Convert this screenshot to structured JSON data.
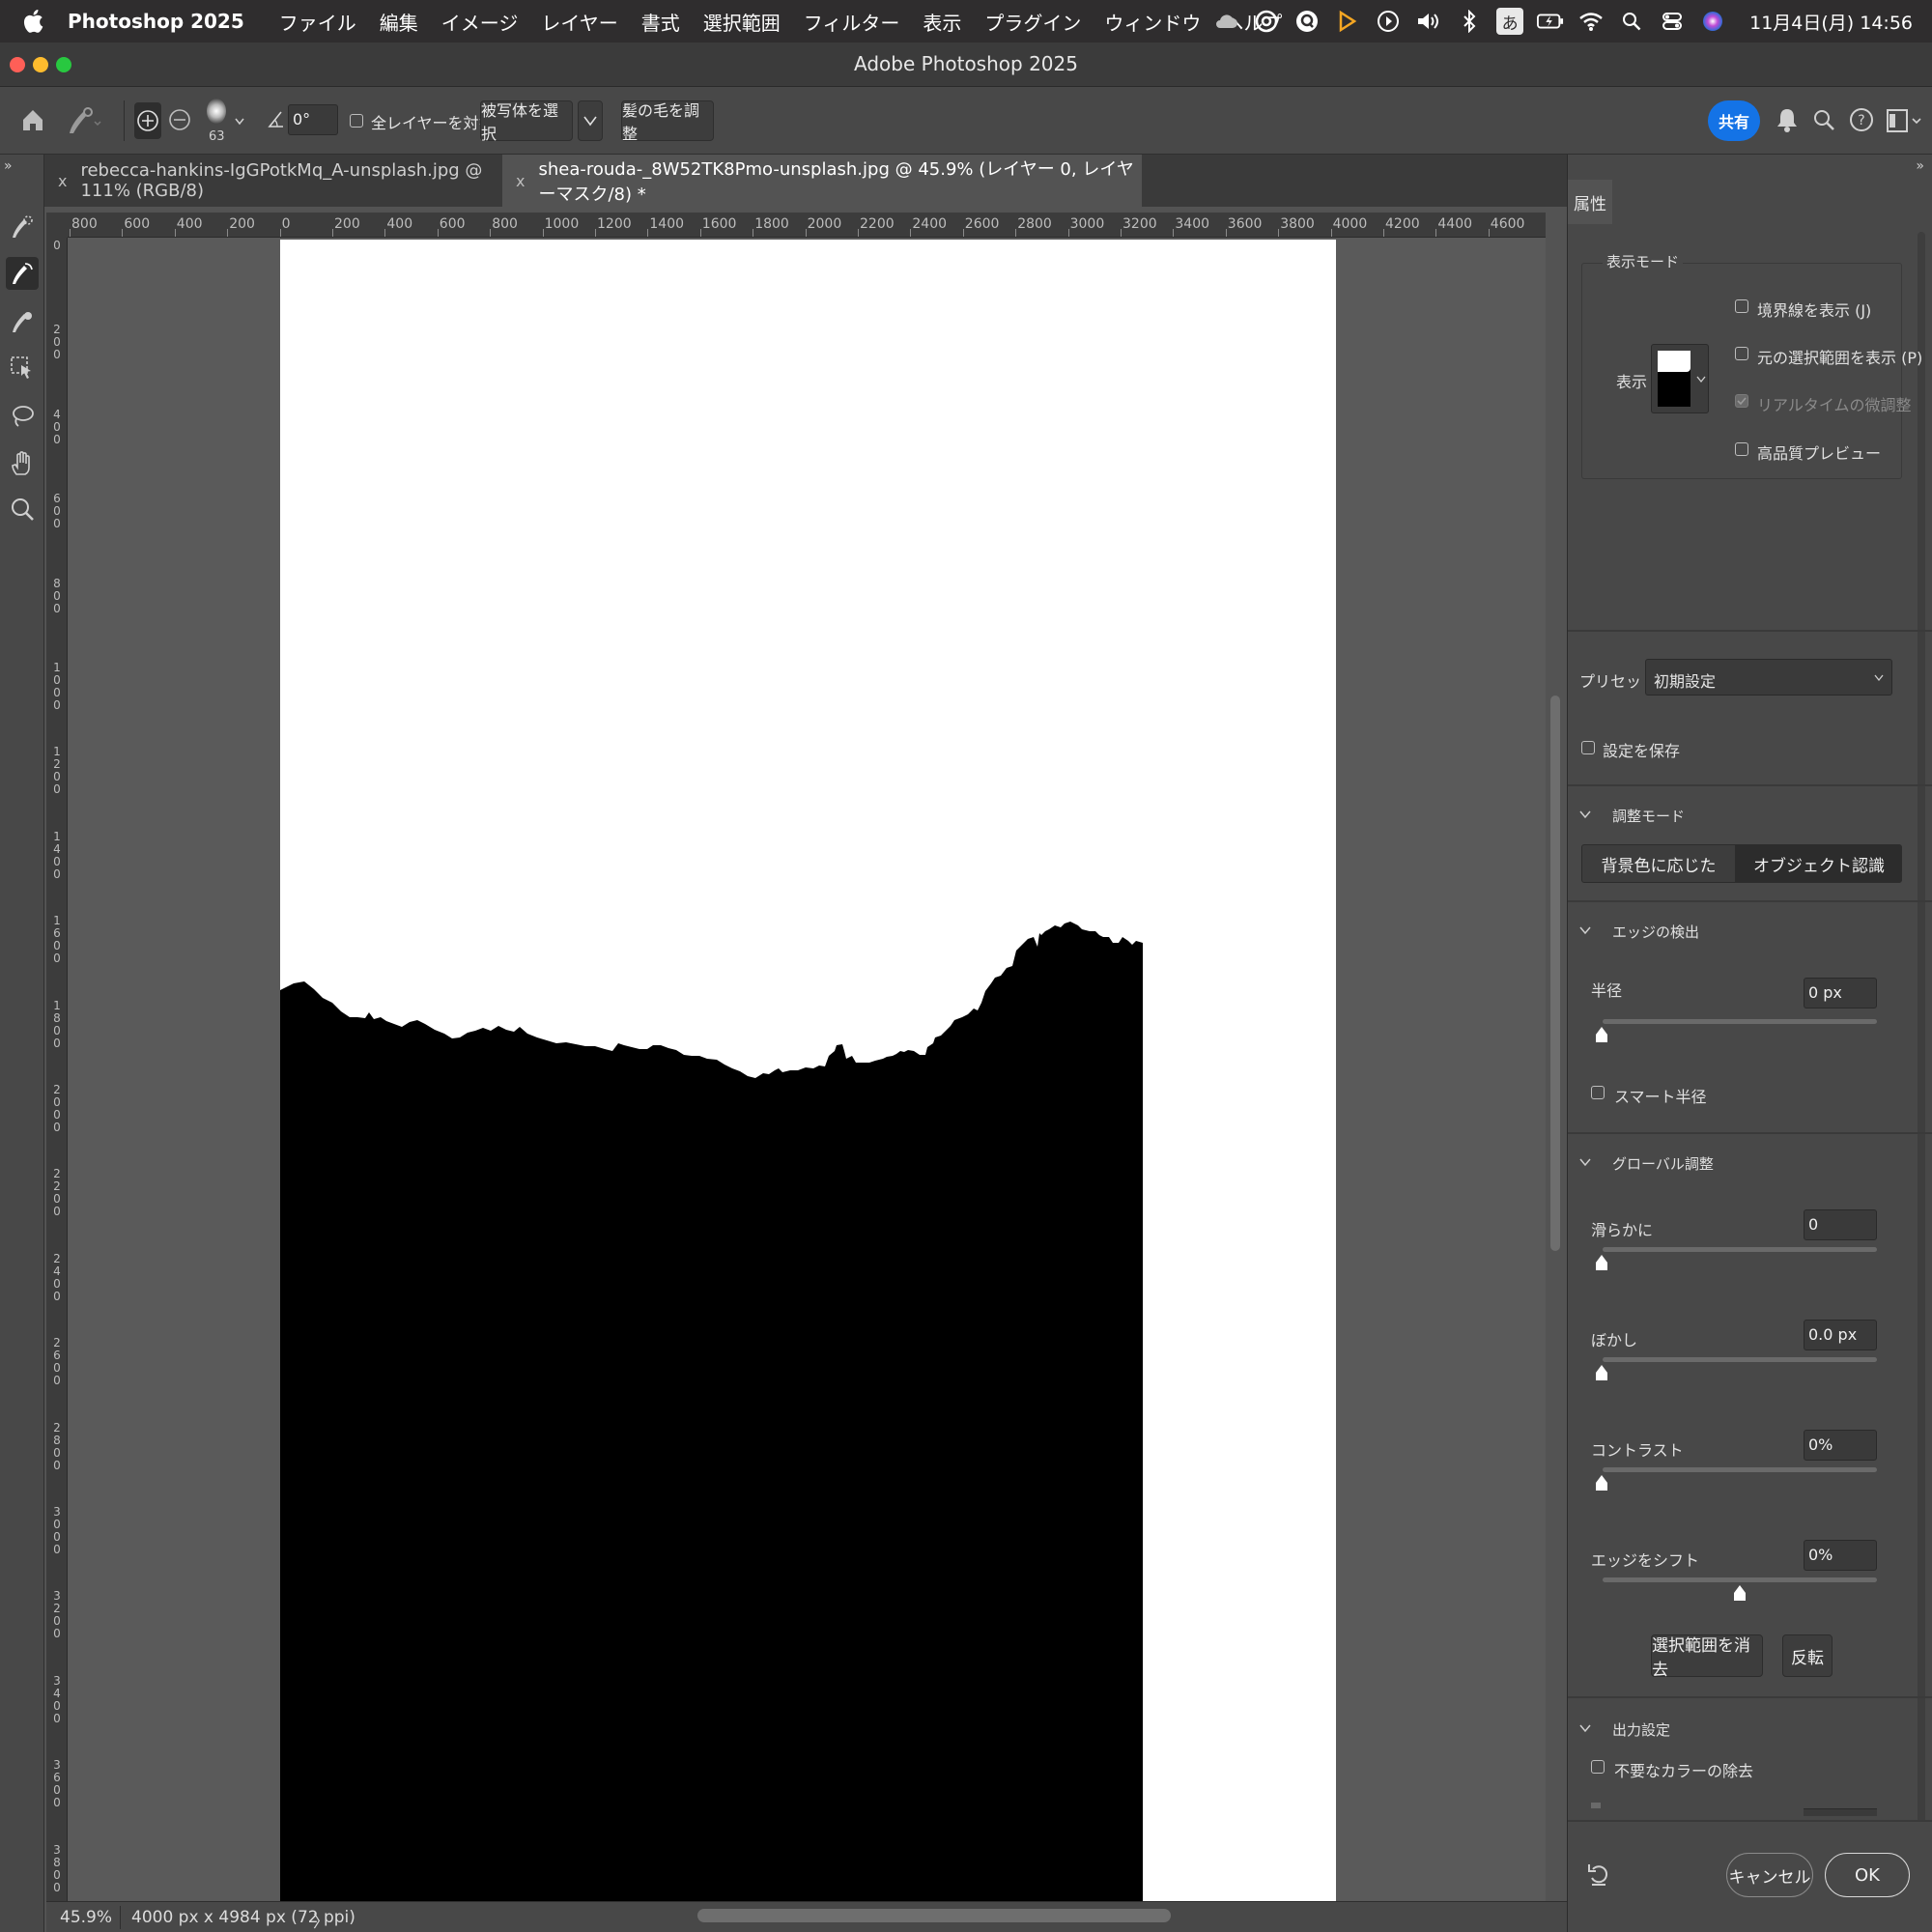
{
  "menubar": {
    "app_name": "Photoshop 2025",
    "items": [
      "ファイル",
      "編集",
      "イメージ",
      "レイヤー",
      "書式",
      "選択範囲",
      "フィルター",
      "表示",
      "プラグイン",
      "ウィンドウ",
      "ヘルプ"
    ],
    "ime": "あ",
    "clock": "11月4日(月) 14:56"
  },
  "window": {
    "title": "Adobe Photoshop 2025"
  },
  "options": {
    "brush_size": "63",
    "angle": "0°",
    "sample_all_layers": "全レイヤーを対象",
    "select_subject": "被写体を選択",
    "refine_hair": "髪の毛を調整",
    "share": "共有"
  },
  "tabs": [
    {
      "label": "rebecca-hankins-IgGPotkMq_A-unsplash.jpg @ 111% (RGB/8)",
      "close": "x"
    },
    {
      "label": "shea-rouda-_8W52TK8Pmo-unsplash.jpg @ 45.9% (レイヤー 0, レイヤーマスク/8) *",
      "close": "x"
    }
  ],
  "ruler": {
    "h_ticks": [
      "800",
      "600",
      "400",
      "200",
      "0",
      "200",
      "400",
      "600",
      "800",
      "1000",
      "1200",
      "1400",
      "1600",
      "1800",
      "2000",
      "2200",
      "2400",
      "2600",
      "2800",
      "3000",
      "3200",
      "3400",
      "3600",
      "3800",
      "4000",
      "4200",
      "4400",
      "4600"
    ],
    "v_ticks": [
      "0",
      "200",
      "400",
      "600",
      "800",
      "1000",
      "1200",
      "1400",
      "1600",
      "1800",
      "2000",
      "2200",
      "2400",
      "2600",
      "2800",
      "3000",
      "3200",
      "3400",
      "3600",
      "3800"
    ]
  },
  "status": {
    "zoom": "45.9%",
    "doc_info": "4000 px x 4984 px (72 ppi)",
    "arrow": "〉"
  },
  "panel": {
    "tab": "属性",
    "view_mode": {
      "title": "表示モード",
      "view_label": "表示",
      "options": [
        {
          "label": "境界線を表示 (J)",
          "checked": false,
          "disabled": false
        },
        {
          "label": "元の選択範囲を表示 (P)",
          "checked": false,
          "disabled": false
        },
        {
          "label": "リアルタイムの微調整",
          "checked": true,
          "disabled": true
        },
        {
          "label": "高品質プレビュー",
          "checked": false,
          "disabled": false
        }
      ]
    },
    "preset": {
      "label": "プリセット",
      "value": "初期設定"
    },
    "save_settings": "設定を保存",
    "refine_mode": {
      "title": "調整モード",
      "color_aware": "背景色に応じた",
      "object_aware": "オブジェクト認識"
    },
    "edge_detection": {
      "title": "エッジの検出",
      "radius_label": "半径",
      "radius_value": "0 px",
      "smart_radius": "スマート半径"
    },
    "global_refinements": {
      "title": "グローバル調整",
      "smooth_label": "滑らかに",
      "smooth_value": "0",
      "smooth_level": 0,
      "feather_label": "ぼかし",
      "feather_value": "0.0 px",
      "feather_level": 0,
      "contrast_label": "コントラスト",
      "contrast_value": "0%",
      "contrast_level": 0,
      "shift_label": "エッジをシフト",
      "shift_value": "0%",
      "shift_level": 0.5
    },
    "clear_selection": "選択範囲を消去",
    "invert": "反転",
    "output": {
      "title": "出力設定",
      "decontaminate": "不要なカラーの除去"
    },
    "cancel": "キャンセル",
    "ok": "OK"
  },
  "colors": {
    "accent": "#1473e6",
    "menubar_bg": "#2f2d2e",
    "panel_bg": "#484848",
    "canvas_bg": "#5a5a5a"
  }
}
